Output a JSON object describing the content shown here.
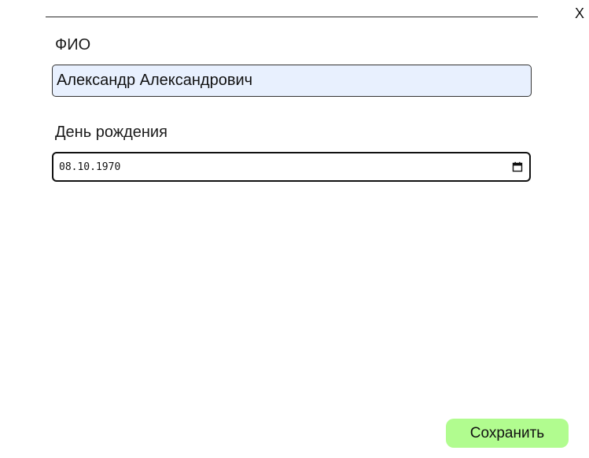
{
  "dialog": {
    "close_label": "X"
  },
  "form": {
    "fio_label": "ФИО",
    "fio_value": "Александр Александрович",
    "birthday_label": "День рождения",
    "birthday_value": "08.10.1970",
    "calendar_icon": "calendar-icon"
  },
  "actions": {
    "save_label": "Сохранить",
    "save_color": "#b1fc8f"
  },
  "colors": {
    "autofill_background": "#e8f0fe"
  }
}
